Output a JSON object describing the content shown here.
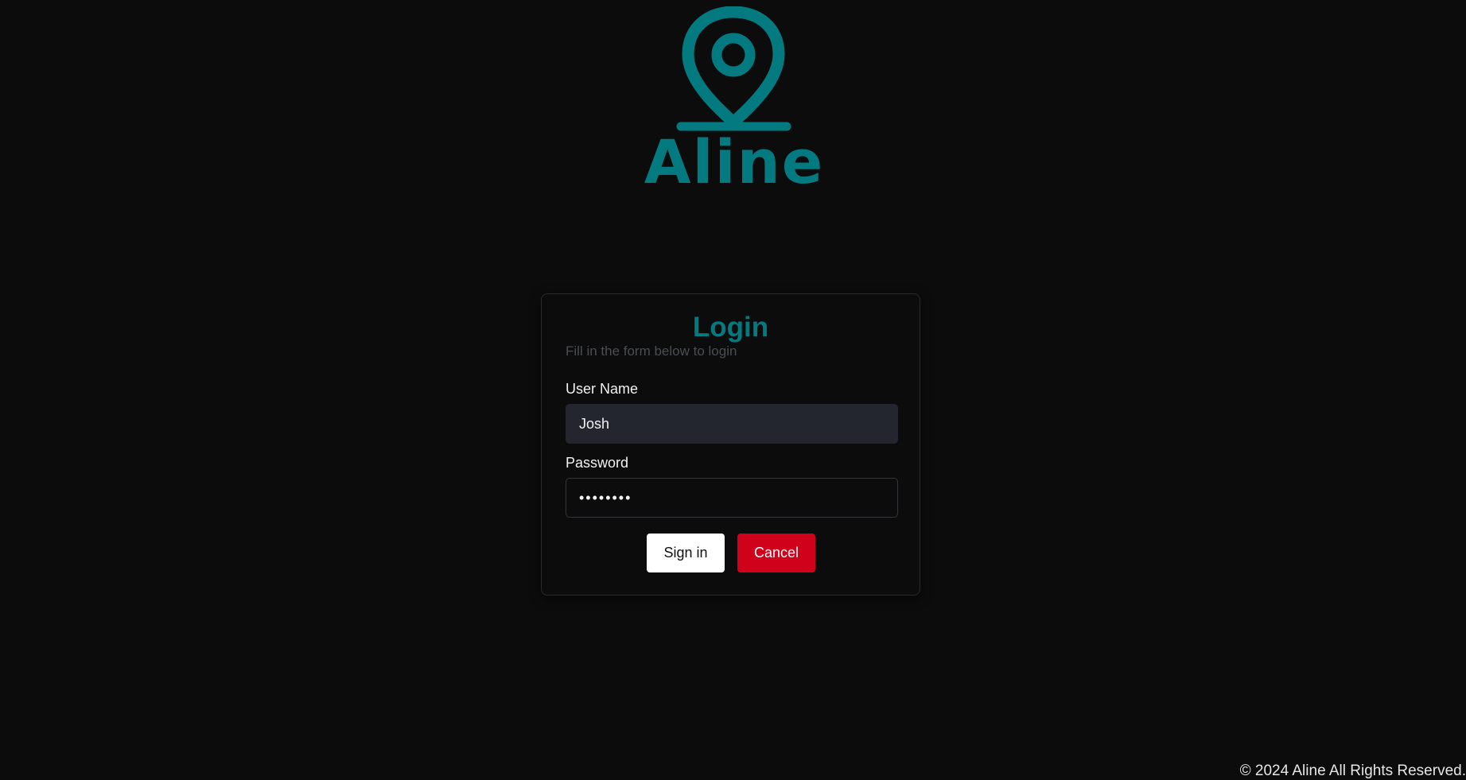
{
  "logo": {
    "text": "Aline",
    "icon": "map-pin-icon",
    "color": "#037a7f"
  },
  "form": {
    "title": "Login",
    "subtitle": "Fill in the form below to login",
    "username_label": "User Name",
    "username_value": "Josh",
    "password_label": "Password",
    "password_value": "••••••••",
    "signin_label": "Sign in",
    "cancel_label": "Cancel"
  },
  "colors": {
    "accent": "#037a7f",
    "cancel": "#d0011b",
    "background": "#0c0c0d"
  },
  "footer": {
    "text": "© 2024 Aline All Rights Reserved."
  }
}
